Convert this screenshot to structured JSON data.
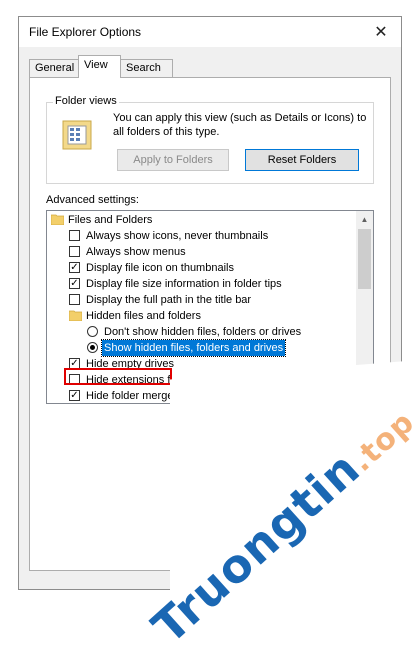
{
  "window": {
    "title": "File Explorer Options"
  },
  "tabs": [
    {
      "label": "General"
    },
    {
      "label": "View"
    },
    {
      "label": "Search"
    }
  ],
  "folder_views": {
    "group_title": "Folder views",
    "description": "You can apply this view (such as Details or Icons) to all folders of this type.",
    "apply_label": "Apply to Folders",
    "reset_label": "Reset Folders"
  },
  "advanced": {
    "label": "Advanced settings:",
    "items": [
      {
        "type": "folder",
        "label": "Files and Folders"
      },
      {
        "type": "checkbox",
        "label": "Always show icons, never thumbnails",
        "checked": false
      },
      {
        "type": "checkbox",
        "label": "Always show menus",
        "checked": false
      },
      {
        "type": "checkbox",
        "label": "Display file icon on thumbnails",
        "checked": true
      },
      {
        "type": "checkbox",
        "label": "Display file size information in folder tips",
        "checked": true
      },
      {
        "type": "checkbox",
        "label": "Display the full path in the title bar",
        "checked": false
      },
      {
        "type": "folder",
        "label": "Hidden files and folders"
      },
      {
        "type": "radio",
        "label": "Don't show hidden files, folders or drives",
        "checked": false
      },
      {
        "type": "radio",
        "label": "Show hidden files, folders and drives",
        "checked": true
      },
      {
        "type": "checkbox",
        "label": "Hide empty drives",
        "checked": true
      },
      {
        "type": "checkbox",
        "label": "Hide extensions f",
        "checked": false
      },
      {
        "type": "checkbox",
        "label": "Hide folder merge",
        "checked": true
      }
    ]
  },
  "watermark": {
    "brand": "Truongtin",
    "tld": ".top"
  },
  "colors": {
    "accent": "#0078d7",
    "highlight": "#e00000",
    "watermark": "#1a67b3"
  }
}
